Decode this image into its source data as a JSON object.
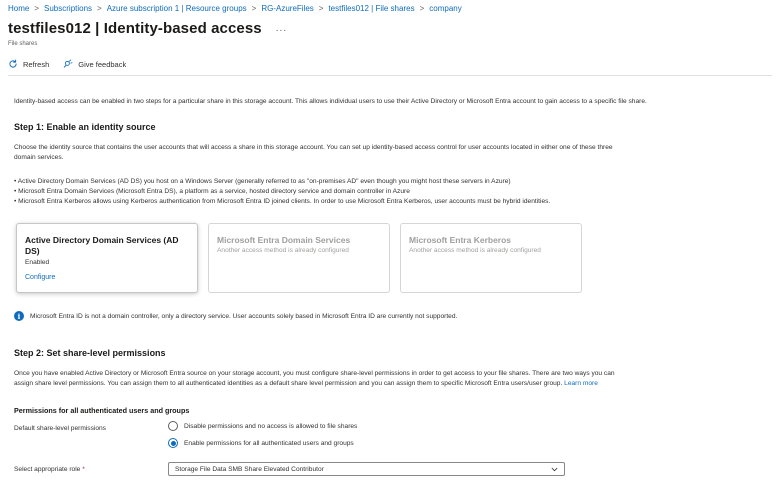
{
  "breadcrumb": {
    "items": [
      "Home",
      "Subscriptions",
      "Azure subscription 1 | Resource groups",
      "RG-AzureFiles",
      "testfiles012 | File shares",
      "company"
    ],
    "separator": ">"
  },
  "header": {
    "title": "testfiles012 | Identity-based access",
    "more": "...",
    "subtitle": "File shares"
  },
  "toolbar": {
    "refresh_label": "Refresh",
    "feedback_label": "Give feedback"
  },
  "intro": "Identity-based access can be enabled in two steps for a particular share in this storage account. This allows individual users to use their Active Directory or Microsoft Entra account to gain access to a specific file share.",
  "step1": {
    "heading": "Step 1: Enable an identity source",
    "description_line1": "Choose the identity source that contains the user accounts that will access a share in this storage account. You can set up identity-based access control for user accounts located in either one of these three",
    "description_line2": "domain services.",
    "bullets": [
      "• Active Directory Domain Services (AD DS) you host on a Windows Server (generally referred to as \"on-premises AD\" even though you might host these servers in Azure)",
      "• Microsoft Entra Domain Services (Microsoft Entra DS), a platform as a service, hosted directory service and domain controller in Azure",
      "• Microsoft Entra Kerberos allows using Kerberos authentication from Microsoft Entra ID joined clients. In order to use Microsoft Entra Kerberos, user accounts must be hybrid identities."
    ],
    "cards": [
      {
        "title": "Active Directory Domain Services (AD DS)",
        "status": "Enabled",
        "link": "Configure"
      },
      {
        "title": "Microsoft Entra Domain Services",
        "status": "Another access method is already configured"
      },
      {
        "title": "Microsoft Entra Kerberos",
        "status": "Another access method is already configured"
      }
    ],
    "info": "Microsoft Entra ID is not a domain controller, only a directory service. User accounts solely based in Microsoft Entra ID are currently not supported."
  },
  "step2": {
    "heading": "Step 2: Set share-level permissions",
    "description_line1": "Once you have enabled Active Directory or Microsoft Entra source on your storage account, you must configure share-level permissions in order to get access to your file shares. There are two ways you can",
    "description_line2": "assign share level permissions. You can assign them to all authenticated identities as a default share level permission and you can assign them to specific Microsoft Entra users/user group.",
    "learn_more": "Learn more",
    "permissions_heading": "Permissions for all authenticated users and groups",
    "default_label": "Default share-level permissions",
    "options": [
      {
        "label": "Disable permissions and no access is allowed to file shares",
        "checked": false
      },
      {
        "label": "Enable permissions for all authenticated users and groups",
        "checked": true
      }
    ],
    "role_label": "Select appropriate role",
    "role_required": "*",
    "role_value": "Storage File Data SMB Share Elevated Contributor"
  },
  "colors": {
    "accent": "#0f6cbd",
    "text": "#323130",
    "disabled": "#a19f9d",
    "required": "#a4262c"
  },
  "icons": [
    "refresh-icon",
    "feedback-icon",
    "info-icon",
    "chevron-down-icon",
    "more-icon"
  ]
}
